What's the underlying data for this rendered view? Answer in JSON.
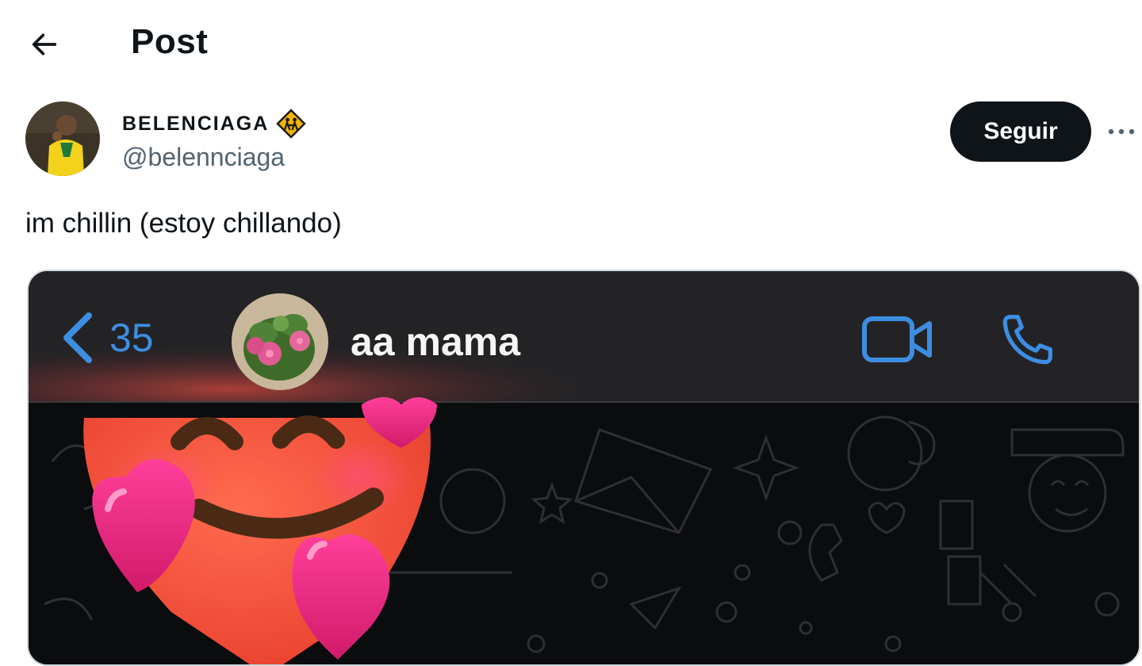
{
  "header": {
    "title": "Post",
    "back_icon": "arrow-left-icon"
  },
  "author": {
    "display_name": "BELENCIAGA",
    "handle": "@belennciaga",
    "badge_icon": "affiliate-badge-icon",
    "follow_label": "Seguir",
    "more_icon": "more-options-icon"
  },
  "tweet": {
    "text": "im chillin (estoy chillando)"
  },
  "media": {
    "chat": {
      "back_count": "35",
      "contact_name": "aa mama",
      "back_icon": "chevron-left-icon",
      "video_icon": "video-camera-icon",
      "call_icon": "phone-icon"
    },
    "sticker": "smiling-face-with-hearts-emoji"
  },
  "colors": {
    "accent_blue": "#3d8ee2",
    "follow_button": "#0f1419",
    "handle_gray": "#536471",
    "badge_gold": "#f4b400"
  }
}
